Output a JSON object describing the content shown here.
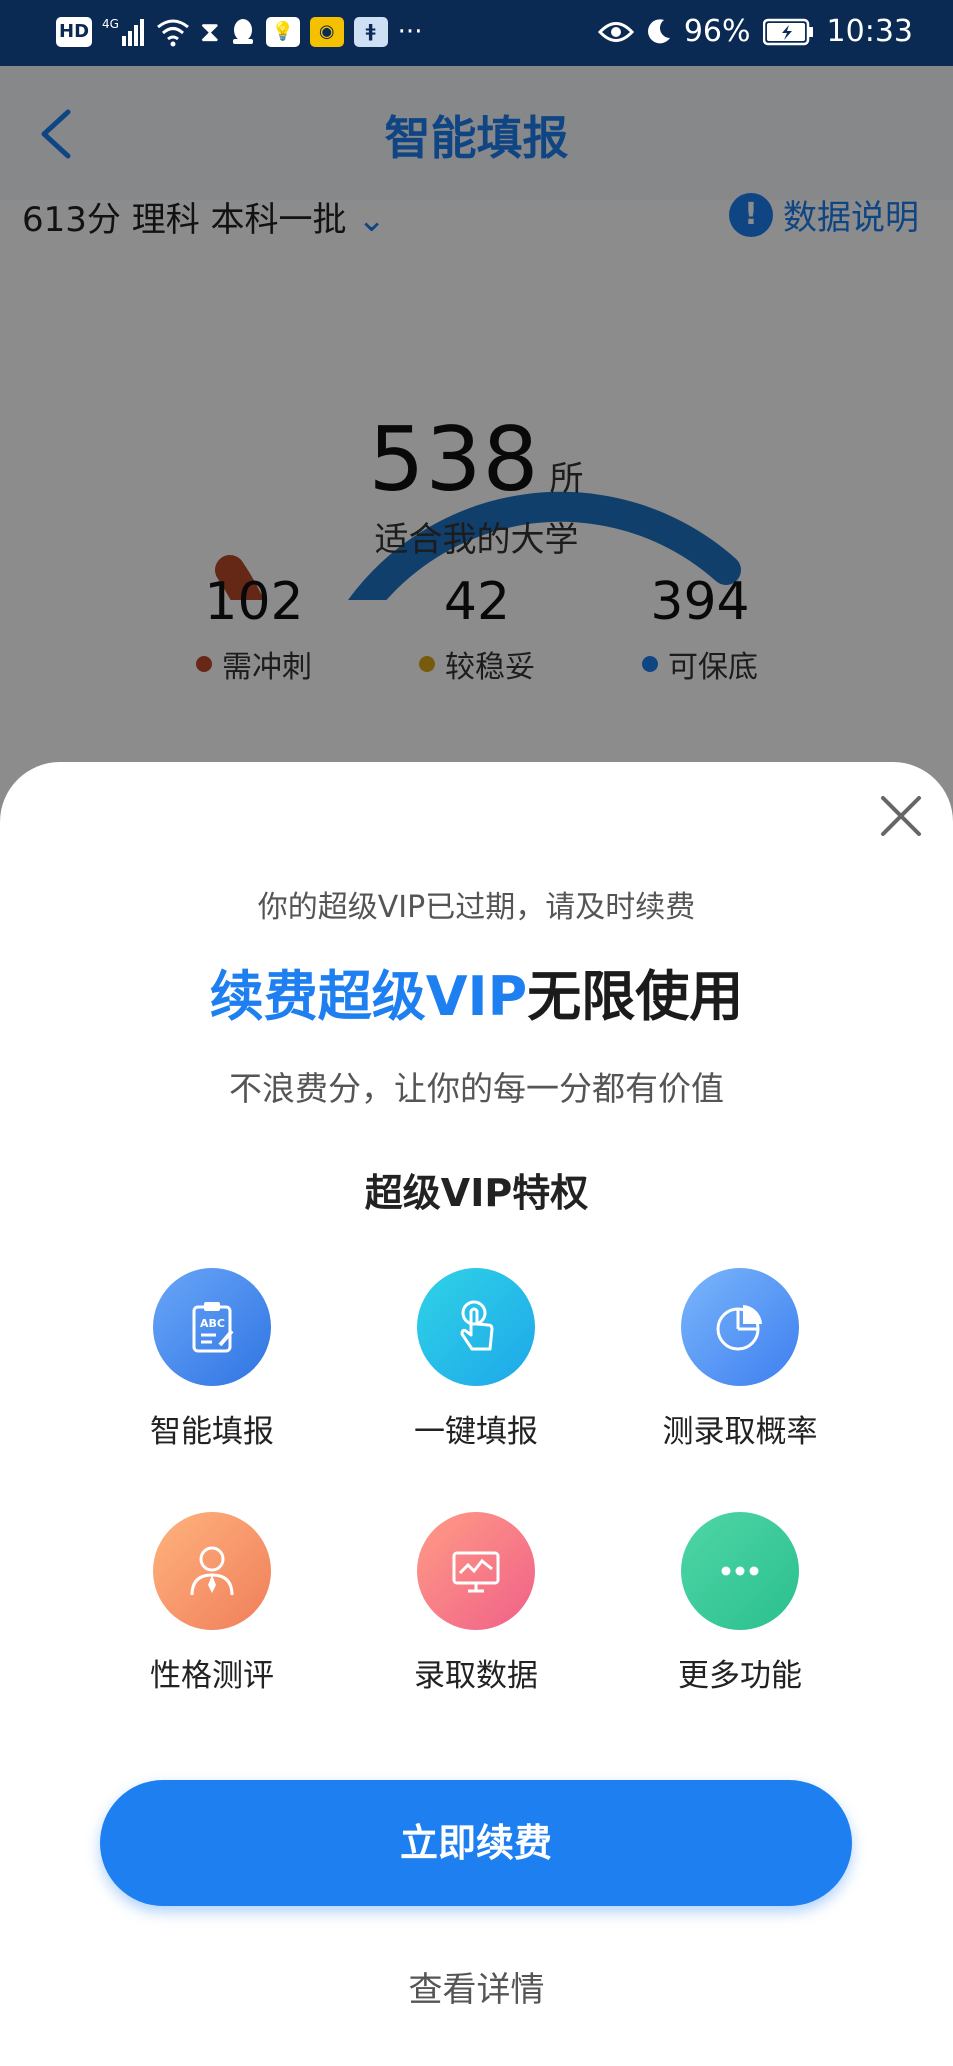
{
  "status_bar": {
    "left_items": [
      "HD",
      "4G",
      "signal",
      "wifi",
      "hourglass",
      "qq",
      "bulb",
      "weibo",
      "app",
      "···"
    ],
    "battery": "96%",
    "time": "10:33"
  },
  "header": {
    "title": "智能填报"
  },
  "score": {
    "text": "613分 理科 本科一批",
    "data_note": "数据说明",
    "info_glyph": "!"
  },
  "gauge": {
    "count": "538",
    "unit": "所",
    "subtitle": "适合我的大学",
    "segments": [
      {
        "name": "需冲刺",
        "value": 102,
        "color": "#b84a2a"
      },
      {
        "name": "较稳妥",
        "value": 42,
        "color": "#c9a11a"
      },
      {
        "name": "可保底",
        "value": 394,
        "color": "#1f73c4"
      }
    ]
  },
  "stats": [
    {
      "num": "102",
      "label": "需冲刺",
      "color": "#c0492b"
    },
    {
      "num": "42",
      "label": "较稳妥",
      "color": "#d9a416"
    },
    {
      "num": "394",
      "label": "可保底",
      "color": "#1e7ff0"
    }
  ],
  "modal": {
    "expired": "你的超级VIP已过期，请及时续费",
    "headline_blue": "续费超级VIP",
    "headline_rest": "无限使用",
    "subtitle": "不浪费分，让你的每一分都有价值",
    "privileges_title": "超级VIP特权",
    "privileges": [
      {
        "label": "智能填报",
        "icon": "clipboard-abc-icon"
      },
      {
        "label": "一键填报",
        "icon": "tap-finger-icon"
      },
      {
        "label": "测录取概率",
        "icon": "pie-chart-icon"
      },
      {
        "label": "性格测评",
        "icon": "person-tie-icon"
      },
      {
        "label": "录取数据",
        "icon": "monitor-chart-icon"
      },
      {
        "label": "更多功能",
        "icon": "more-dots-icon"
      }
    ],
    "cta": "立即续费",
    "details": "查看详情"
  }
}
